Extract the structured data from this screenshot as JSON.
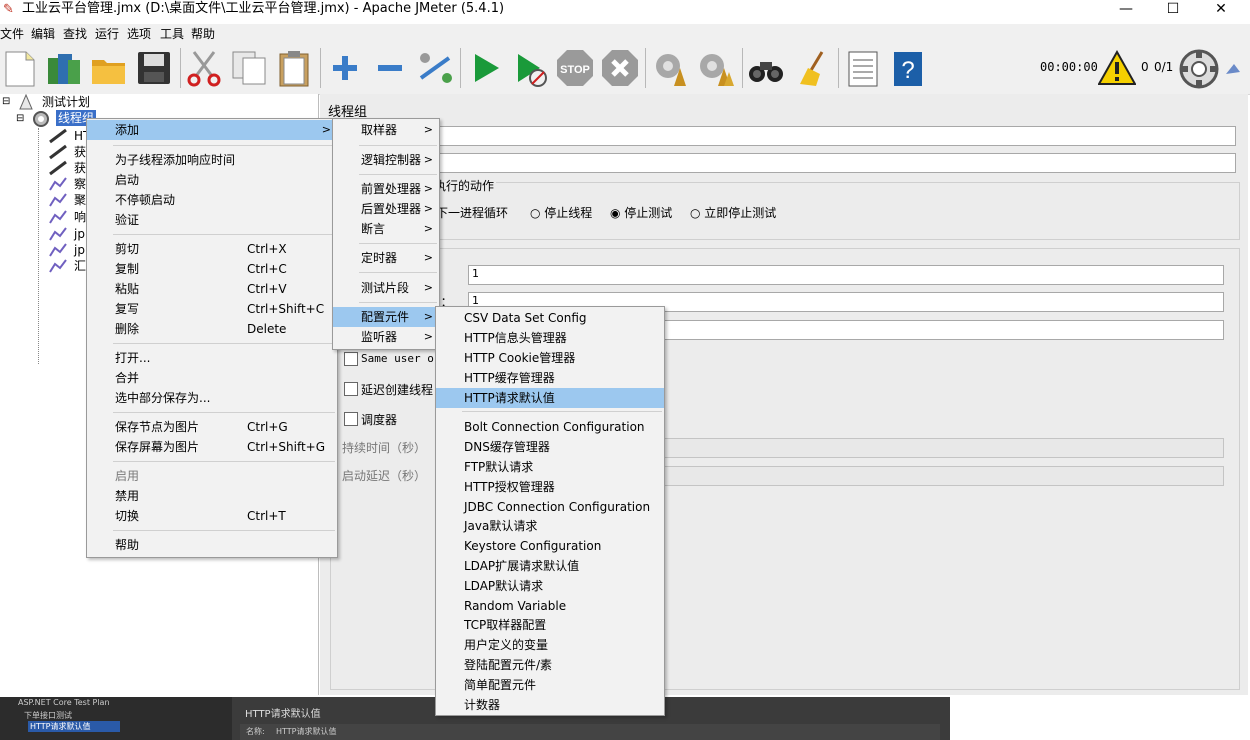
{
  "window": {
    "title": "工业云平台管理.jmx (D:\\桌面文件\\工业云平台管理.jmx) - Apache JMeter (5.4.1)",
    "minimize": "—",
    "maximize": "☐",
    "close": "✕"
  },
  "menubar": [
    "文件",
    "编辑",
    "查找",
    "运行",
    "选项",
    "工具",
    "帮助"
  ],
  "toolbar": {
    "timer": "00:00:00",
    "warning_count": "0",
    "threads": "0/1",
    "icons": [
      "new-icon",
      "templates-icon",
      "open-icon",
      "save-icon",
      "cut-icon",
      "copy-icon",
      "paste-icon",
      "expand-icon",
      "collapse-icon",
      "toggle-icon",
      "start-icon",
      "start-no-pause-icon",
      "stop-icon",
      "shutdown-icon",
      "clear-icon",
      "clear-all-icon",
      "search-icon",
      "reset-search-icon",
      "function-helper-icon",
      "help-icon"
    ]
  },
  "tree": {
    "root": "测试计划",
    "selected": "线程组",
    "children": [
      "HT",
      "获",
      "获",
      "察",
      "聚",
      "响",
      "jp",
      "jp",
      "汇"
    ]
  },
  "right_panel": {
    "title": "线程组",
    "action_group_label": "执行的动作",
    "radio_options": [
      "启动下一进程循环",
      "停止线程",
      "停止测试",
      "立即停止测试"
    ],
    "radio_visible_first": "下一进程循环",
    "selected_radio": "停止测试",
    "thread_count_value": "1",
    "ramp_value": "1",
    "partial_label": ")：",
    "same_user_label": "Same user o",
    "delay_label": "延迟创建线程",
    "scheduler_label": "调度器",
    "duration_label": "持续时间（秒）",
    "startup_delay_label": "启动延迟（秒）"
  },
  "context_menu": [
    {
      "label": "添加",
      "arrow": ">",
      "highlight": true
    },
    {
      "sep": true
    },
    {
      "label": "为子线程添加响应时间"
    },
    {
      "label": "启动"
    },
    {
      "label": "不停顿启动"
    },
    {
      "label": "验证"
    },
    {
      "sep": true
    },
    {
      "label": "剪切",
      "shortcut": "Ctrl+X"
    },
    {
      "label": "复制",
      "shortcut": "Ctrl+C"
    },
    {
      "label": "粘贴",
      "shortcut": "Ctrl+V"
    },
    {
      "label": "复写",
      "shortcut": "Ctrl+Shift+C"
    },
    {
      "label": "删除",
      "shortcut": "Delete"
    },
    {
      "sep": true
    },
    {
      "label": "打开..."
    },
    {
      "label": "合并"
    },
    {
      "label": "选中部分保存为..."
    },
    {
      "sep": true
    },
    {
      "label": "保存节点为图片",
      "shortcut": "Ctrl+G"
    },
    {
      "label": "保存屏幕为图片",
      "shortcut": "Ctrl+Shift+G"
    },
    {
      "sep": true
    },
    {
      "label": "启用",
      "disabled": true
    },
    {
      "label": "禁用"
    },
    {
      "label": "切换",
      "shortcut": "Ctrl+T"
    },
    {
      "sep": true
    },
    {
      "label": "帮助"
    }
  ],
  "add_submenu": [
    {
      "label": "取样器",
      "arrow": ">"
    },
    {
      "sep": true
    },
    {
      "label": "逻辑控制器",
      "arrow": ">"
    },
    {
      "sep": true
    },
    {
      "label": "前置处理器",
      "arrow": ">"
    },
    {
      "label": "后置处理器",
      "arrow": ">"
    },
    {
      "label": "断言",
      "arrow": ">"
    },
    {
      "sep": true
    },
    {
      "label": "定时器",
      "arrow": ">"
    },
    {
      "sep": true
    },
    {
      "label": "测试片段",
      "arrow": ">"
    },
    {
      "sep": true
    },
    {
      "label": "配置元件",
      "arrow": ">",
      "highlight": true
    },
    {
      "label": "监听器",
      "arrow": ">"
    }
  ],
  "config_submenu": [
    {
      "label": "CSV Data Set Config"
    },
    {
      "label": "HTTP信息头管理器"
    },
    {
      "label": "HTTP Cookie管理器"
    },
    {
      "label": "HTTP缓存管理器"
    },
    {
      "label": "HTTP请求默认值",
      "highlight": true
    },
    {
      "sep": true
    },
    {
      "label": "Bolt Connection Configuration"
    },
    {
      "label": "DNS缓存管理器"
    },
    {
      "label": "FTP默认请求"
    },
    {
      "label": "HTTP授权管理器"
    },
    {
      "label": "JDBC Connection Configuration"
    },
    {
      "label": "Java默认请求"
    },
    {
      "label": "Keystore Configuration"
    },
    {
      "label": "LDAP扩展请求默认值"
    },
    {
      "label": "LDAP默认请求"
    },
    {
      "label": "Random Variable"
    },
    {
      "label": "TCP取样器配置"
    },
    {
      "label": "用户定义的变量"
    },
    {
      "label": "登陆配置元件/素"
    },
    {
      "label": "简单配置元件"
    },
    {
      "label": "计数器"
    }
  ],
  "bottom_inset": {
    "tree_root": "ASP.NET Core Test Plan",
    "tree_child": "下单接口测试",
    "tree_selected": "HTTP请求默认值",
    "panel_title": "HTTP请求默认值",
    "name_label": "名称:",
    "name_value": "HTTP请求默认值"
  }
}
